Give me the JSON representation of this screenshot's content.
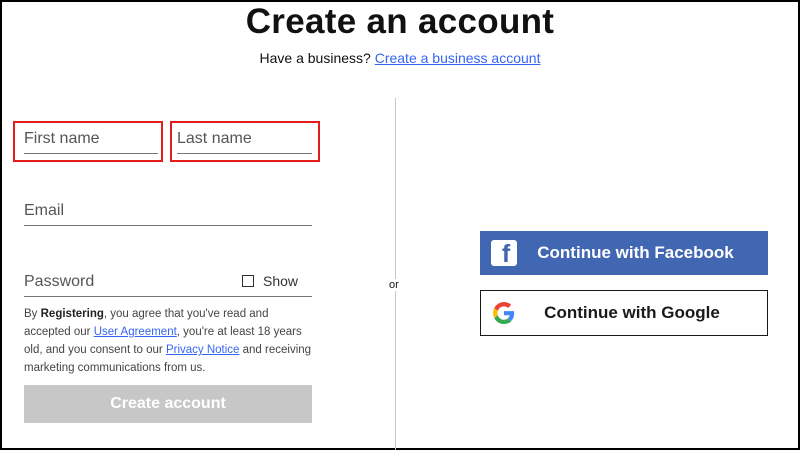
{
  "header": {
    "title": "Create an account",
    "subtitle_prefix": "Have a business?",
    "business_link": "Create a business account"
  },
  "form": {
    "first_name_placeholder": "First name",
    "last_name_placeholder": "Last name",
    "email_placeholder": "Email",
    "password_placeholder": "Password",
    "show_label": "Show",
    "show_checked": false,
    "legal": {
      "prefix": "By ",
      "registering": "Registering",
      "part1": ", you agree that you've read and accepted our ",
      "user_agreement": "User Agreement",
      "part2": ", you're at least 18 years old, and you consent to our ",
      "privacy_notice": "Privacy Notice",
      "part3": " and receiving marketing communications from us."
    },
    "submit_label": "Create account"
  },
  "divider_label": "or",
  "social": {
    "facebook_label": "Continue with Facebook",
    "google_label": "Continue with Google"
  },
  "colors": {
    "link": "#3665f3",
    "facebook": "#4267b2",
    "submit_disabled": "#c7c7c7",
    "highlight": "#e31c1c"
  },
  "icons": {
    "facebook": "facebook-logo-icon",
    "google": "google-logo-icon",
    "checkbox": "checkbox-icon"
  }
}
